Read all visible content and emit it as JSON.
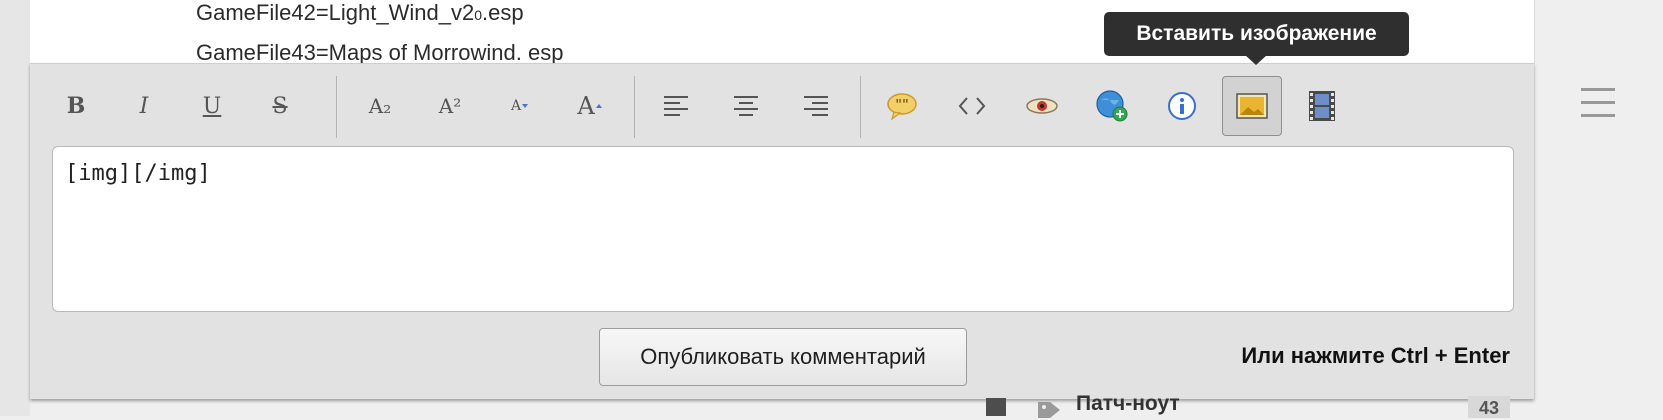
{
  "content": {
    "line1_main": "GameFile42=Light_Wind_v2",
    "line1_sub": "0",
    "line1_end": ".esp",
    "line2": "GameFile43=Maps of Morrowind. esp"
  },
  "toolbar": {
    "buttons": [
      {
        "name": "bold-button",
        "glyph": "B"
      },
      {
        "name": "italic-button",
        "glyph": "I"
      },
      {
        "name": "underline-button",
        "glyph": "U"
      },
      {
        "name": "strikethrough-button",
        "glyph": "S"
      },
      {
        "name": "subscript-button",
        "glyph": "A₂"
      },
      {
        "name": "superscript-button",
        "glyph": "A²"
      },
      {
        "name": "font-size-decrease-button",
        "glyph": "A"
      },
      {
        "name": "font-size-increase-button",
        "glyph": "A"
      }
    ],
    "active_button": "insert-image-button"
  },
  "tooltip": {
    "text": "Вставить изображение"
  },
  "editor": {
    "textarea_value": "[img][/img]",
    "publish_label": "Опубликовать комментарий",
    "hint": "Или нажмите Ctrl + Enter"
  },
  "sidebar": {
    "tag_label": "Патч-ноут",
    "tag_count": "43"
  }
}
